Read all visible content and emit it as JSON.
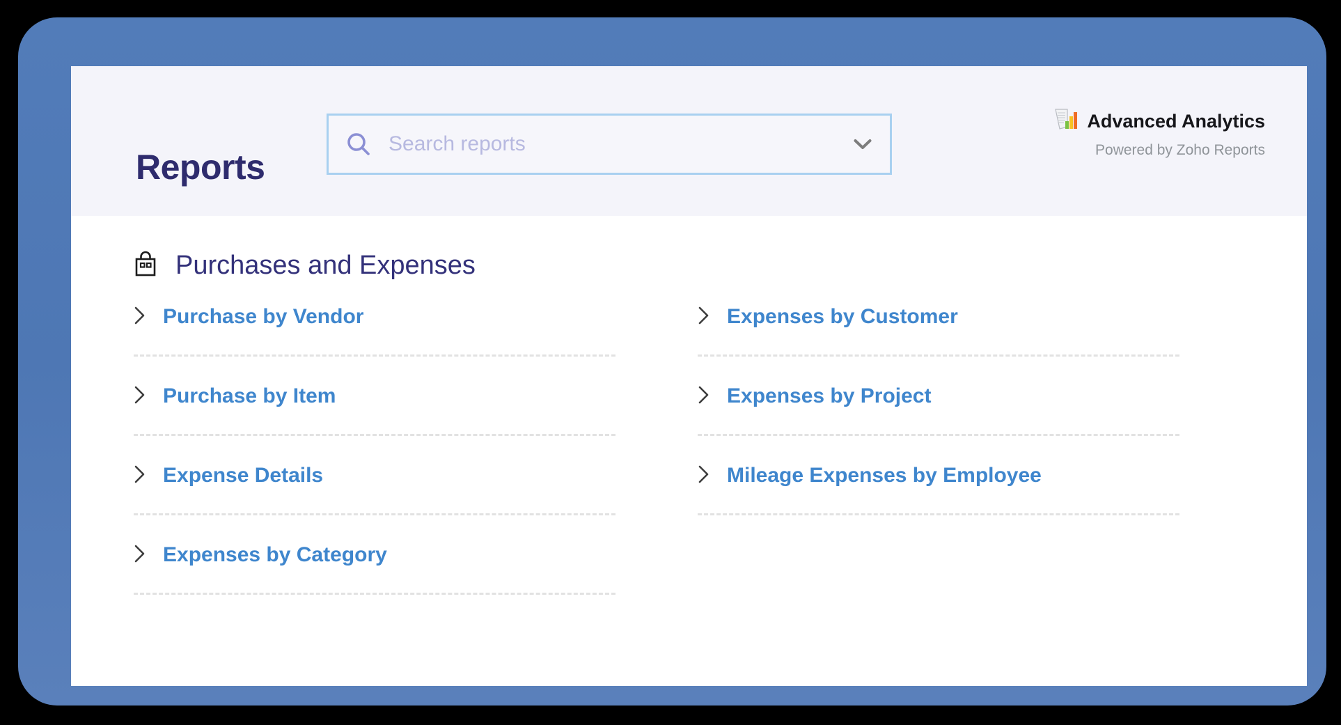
{
  "header": {
    "title": "Reports",
    "search": {
      "placeholder": "Search reports",
      "value": "",
      "icon": "search-icon",
      "dropdown_icon": "chevron-down-icon"
    },
    "branding": {
      "icon": "document-chart-icon",
      "title": "Advanced Analytics",
      "subtitle": "Powered by Zoho Reports"
    }
  },
  "section": {
    "icon": "shopping-bag-icon",
    "title": "Purchases and Expenses",
    "columns": [
      {
        "items": [
          {
            "label": "Purchase by Vendor",
            "icon": "chevron-right-icon"
          },
          {
            "label": "Purchase by Item",
            "icon": "chevron-right-icon"
          },
          {
            "label": "Expense Details",
            "icon": "chevron-right-icon"
          },
          {
            "label": "Expenses by Category",
            "icon": "chevron-right-icon"
          }
        ]
      },
      {
        "items": [
          {
            "label": "Expenses by Customer",
            "icon": "chevron-right-icon"
          },
          {
            "label": "Expenses by Project",
            "icon": "chevron-right-icon"
          },
          {
            "label": "Mileage Expenses by Employee",
            "icon": "chevron-right-icon"
          }
        ]
      }
    ]
  },
  "colors": {
    "frame_blue": "#527cb9",
    "header_bg": "#f4f4fa",
    "title_navy": "#2e2b6d",
    "link_blue": "#3f86cd",
    "section_title": "#33317a",
    "search_border": "#a8d0f0",
    "placeholder": "#b7b9e0",
    "divider": "#e2e2e2"
  }
}
